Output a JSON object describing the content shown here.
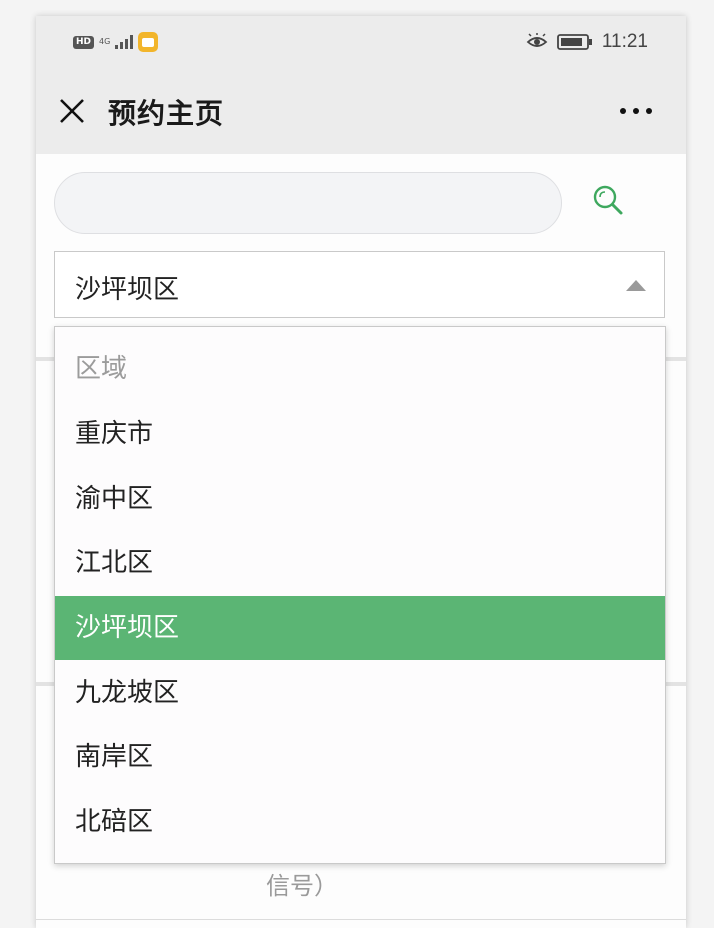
{
  "status_bar": {
    "network_badge": "HD",
    "network_type": "4G",
    "time": "11:21"
  },
  "header": {
    "title": "预约主页"
  },
  "search": {
    "placeholder": ""
  },
  "district_select": {
    "selected_value": "沙坪坝区",
    "options": [
      {
        "label": "区域",
        "is_header": true
      },
      {
        "label": "重庆市"
      },
      {
        "label": "渝中区"
      },
      {
        "label": "江北区"
      },
      {
        "label": "沙坪坝区",
        "selected": true
      },
      {
        "label": "九龙坡区"
      },
      {
        "label": "南岸区"
      },
      {
        "label": "北碚区"
      }
    ]
  },
  "background": {
    "partial_text": "信号）"
  },
  "colors": {
    "accent": "#5bb574",
    "search_icon": "#3ea85e",
    "header_bg": "#ececec"
  }
}
